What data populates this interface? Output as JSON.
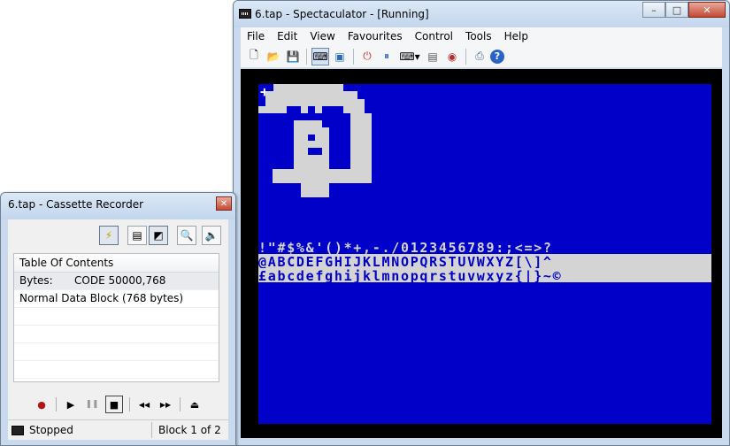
{
  "spectaculator": {
    "title": "6.tap - Spectaculator - [Running]",
    "caption_buttons": [
      "–",
      "□",
      "✕"
    ],
    "menu": [
      "File",
      "Edit",
      "View",
      "Favourites",
      "Control",
      "Tools",
      "Help"
    ],
    "toolbar": [
      {
        "name": "new-icon",
        "glyph": "🗋"
      },
      {
        "name": "open-folder-icon",
        "glyph": "📂"
      },
      {
        "name": "save-icon",
        "glyph": "💾"
      },
      {
        "name": "sep"
      },
      {
        "name": "keyboard-icon",
        "glyph": "⌨",
        "pressed": true
      },
      {
        "name": "window-icon",
        "glyph": "▣"
      },
      {
        "name": "sep"
      },
      {
        "name": "reset-icon",
        "glyph": "⏻"
      },
      {
        "name": "pause-icon",
        "glyph": "⏸"
      },
      {
        "name": "joystick-keyboard-icon",
        "glyph": "⌨▾"
      },
      {
        "name": "tape-icon",
        "glyph": "▤"
      },
      {
        "name": "record-settings-icon",
        "glyph": "◉"
      },
      {
        "name": "sep"
      },
      {
        "name": "printer-icon",
        "glyph": "⎙"
      },
      {
        "name": "help-icon",
        "glyph": "?"
      }
    ],
    "screen": {
      "cursor": "+",
      "line1": " !\"#$%&'()*+,-./0123456789:;<=>?",
      "line2": "@ABCDEFGHIJKLMNOPQRSTUVWXYZ[\\]^_",
      "line3": "£abcdefghijklmnopqrstuvwxyz{|}~©",
      "colors": {
        "paper": "#0000c8",
        "ink": "#d4d4d4",
        "border": "#000000"
      }
    }
  },
  "cassette": {
    "title": "6.tap - Cassette Recorder",
    "close": "✕",
    "tools": [
      {
        "name": "fast-load-icon",
        "glyph": "⚡",
        "pressed": true
      },
      {
        "name": "tape-traps-icon",
        "glyph": "▤"
      },
      {
        "name": "flash-load-icon",
        "glyph": "◩",
        "pressed": true
      },
      {
        "name": "browse-icon",
        "glyph": "🔍"
      },
      {
        "name": "sound-icon",
        "glyph": "🔈"
      }
    ],
    "toc_header": "Table Of Contents",
    "rows": [
      {
        "label": "Bytes:",
        "value": "CODE 50000,768"
      },
      {
        "label": "Normal Data Block (768 bytes)",
        "value": ""
      }
    ],
    "transport": {
      "record": "●",
      "play": "▶",
      "pause": "❚❚",
      "stop": "■",
      "rewind": "◀◀",
      "forward": "▶▶",
      "eject": "⏏"
    },
    "status": "Stopped",
    "block": "Block 1 of 2"
  }
}
